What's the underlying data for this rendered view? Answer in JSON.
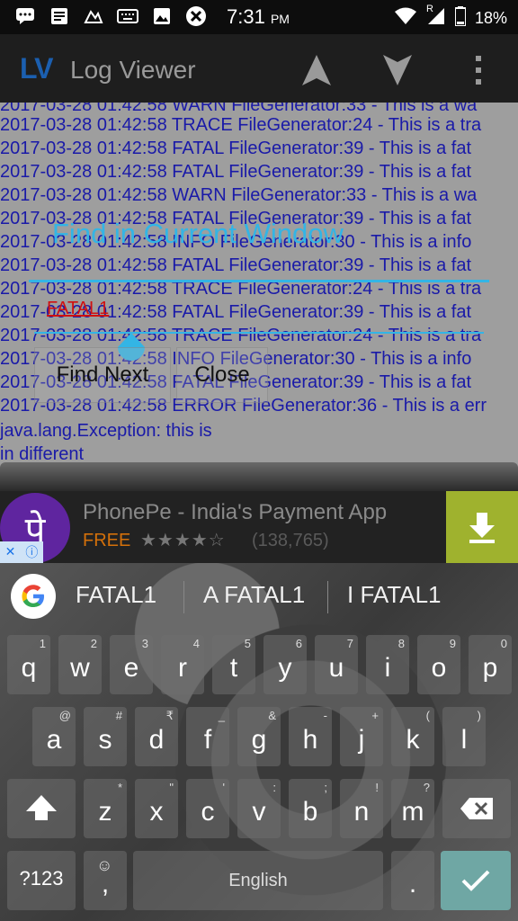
{
  "status_bar": {
    "time": "7:31",
    "ampm": "PM",
    "battery": "18%",
    "network_r": "R",
    "left_icons": [
      "messages-icon",
      "notes-icon",
      "app-icon",
      "keyboard-icon",
      "image-icon",
      "sync-icon"
    ]
  },
  "app_bar": {
    "logo": "LV",
    "title": "Log Viewer"
  },
  "log": {
    "lines": [
      "2017-03-28 01:42:58 WARN  FileGenerator:33 - This is a wa",
      "2017-03-28 01:42:58 TRACE FileGenerator:24 - This is a tra",
      "2017-03-28 01:42:58 FATAL FileGenerator:39 - This is a fat",
      "2017-03-28 01:42:58 FATAL FileGenerator:39 - This is a fat",
      "2017-03-28 01:42:58 WARN  FileGenerator:33 - This is a wa",
      "2017-03-28 01:42:58 FATAL FileGenerator:39 - This is a fat",
      "2017-03-28 01:42:58 INFO  FileGenerator:30 - This is a info",
      "2017-03-28 01:42:58 FATAL FileGenerator:39 - This is a fat",
      "2017-03-28 01:42:58 TRACE FileGenerator:24 - This is a tra",
      "2017-03-28 01:42:58 FATAL FileGenerator:39 - This is a fat",
      "2017-03-28 01:42:58 TRACE FileGenerator:24 - This is a tra",
      "2017-03-28 01:42:58 INFO  FileGenerator:30 - This is a info",
      "2017-03-28 01:42:58 FATAL FileGenerator:39 - This is a fat",
      "2017-03-28 01:42:58 ERROR FileGenerator:36 - This is a err",
      "java.lang.Exception: this is",
      "in different"
    ]
  },
  "dialog": {
    "title": "Find in Current Window",
    "input_value": "FATAL1",
    "find_next": "Find Next",
    "close": "Close"
  },
  "ad": {
    "icon_text": "पे",
    "title": "PhonePe - India's Payment App",
    "free": "FREE",
    "stars": "★★★★☆",
    "rating_count": "(138,765)"
  },
  "keyboard": {
    "suggestions": [
      "FATAL1",
      "A FATAL1",
      "I FATAL1"
    ],
    "row1": [
      {
        "k": "q",
        "s": "1"
      },
      {
        "k": "w",
        "s": "2"
      },
      {
        "k": "e",
        "s": "3"
      },
      {
        "k": "r",
        "s": "4"
      },
      {
        "k": "t",
        "s": "5"
      },
      {
        "k": "y",
        "s": "6"
      },
      {
        "k": "u",
        "s": "7"
      },
      {
        "k": "i",
        "s": "8"
      },
      {
        "k": "o",
        "s": "9"
      },
      {
        "k": "p",
        "s": "0"
      }
    ],
    "row2": [
      {
        "k": "a",
        "s": "@"
      },
      {
        "k": "s",
        "s": "#"
      },
      {
        "k": "d",
        "s": "₹"
      },
      {
        "k": "f",
        "s": "_"
      },
      {
        "k": "g",
        "s": "&"
      },
      {
        "k": "h",
        "s": "-"
      },
      {
        "k": "j",
        "s": "+"
      },
      {
        "k": "k",
        "s": "("
      },
      {
        "k": "l",
        "s": ")"
      }
    ],
    "row3": [
      {
        "k": "z",
        "s": "*"
      },
      {
        "k": "x",
        "s": "\""
      },
      {
        "k": "c",
        "s": "'"
      },
      {
        "k": "v",
        "s": ":"
      },
      {
        "k": "b",
        "s": ";"
      },
      {
        "k": "n",
        "s": "!"
      },
      {
        "k": "m",
        "s": "?"
      }
    ],
    "symbols_key": "?123",
    "comma_key": ",",
    "space_label": "English",
    "period_key": "."
  },
  "colors": {
    "accent": "#33b5e5",
    "log_text": "#1a1aa8",
    "log_bg": "#9e9e9e",
    "highlight": "#d01010",
    "enter_key": "#6fa7a4"
  }
}
